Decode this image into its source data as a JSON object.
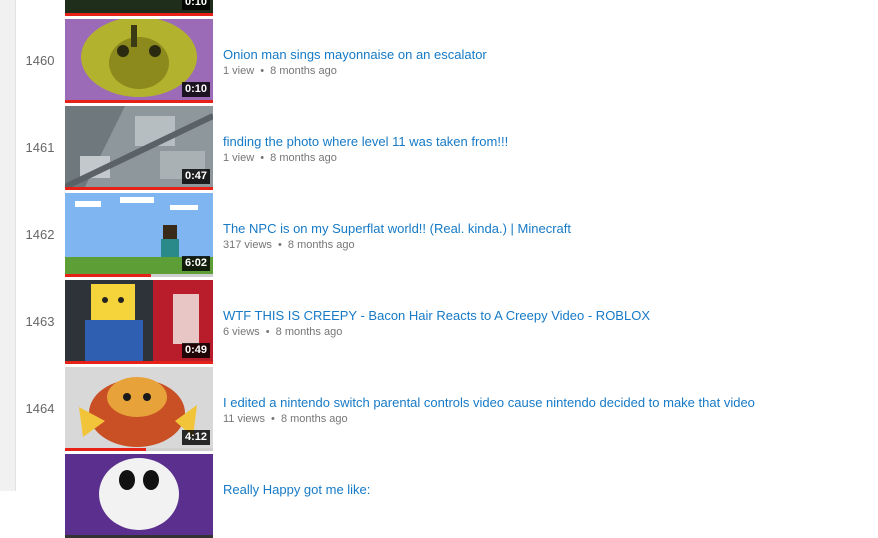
{
  "playlist": {
    "items": [
      {
        "index": "",
        "title": "",
        "views": "",
        "age": "",
        "duration": "0:10",
        "progress": 1.0,
        "thumb_colors": [
          "#3c5a2e",
          "#1e2e1a"
        ]
      },
      {
        "index": "1460",
        "title": "Onion man sings mayonnaise on an escalator",
        "views": "1 view",
        "age": "8 months ago",
        "duration": "0:10",
        "progress": 1.0,
        "thumb_colors": [
          "#b8b634",
          "#8a5fa8"
        ]
      },
      {
        "index": "1461",
        "title": "finding the photo where level 11 was taken from!!!",
        "views": "1 view",
        "age": "8 months ago",
        "duration": "0:47",
        "progress": 1.0,
        "thumb_colors": [
          "#9aa3a8",
          "#5c666c"
        ]
      },
      {
        "index": "1462",
        "title": "The NPC is on my Superflat world!! (Real. kinda.) | Minecraft",
        "views": "317 views",
        "age": "8 months ago",
        "duration": "6:02",
        "progress": 0.58,
        "thumb_colors": [
          "#7fb6f2",
          "#5d9e37"
        ]
      },
      {
        "index": "1463",
        "title": "WTF THIS IS CREEPY - Bacon Hair Reacts to A Creepy Video - ROBLOX",
        "views": "6 views",
        "age": "8 months ago",
        "duration": "0:49",
        "progress": 1.0,
        "thumb_colors": [
          "#3a3f48",
          "#b91c2a"
        ]
      },
      {
        "index": "1464",
        "title": "I edited a nintendo switch parental controls video cause nintendo decided to make that video",
        "views": "11 views",
        "age": "8 months ago",
        "duration": "4:12",
        "progress": 0.55,
        "thumb_colors": [
          "#d8d8d8",
          "#c94f24"
        ]
      },
      {
        "index": "",
        "title": "Really Happy got me like:",
        "views": "",
        "age": "",
        "duration": "",
        "progress": 0.0,
        "thumb_colors": [
          "#5a2f8e",
          "#f2f2f2"
        ]
      }
    ],
    "separator": "•"
  },
  "colors": {
    "link": "#167ac6",
    "progress": "#e62117"
  }
}
